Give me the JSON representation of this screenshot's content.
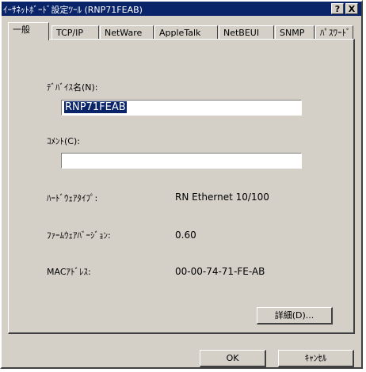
{
  "window": {
    "title": "ｲｰｻﾈｯﾄﾎﾞｰﾄﾞ設定ﾂｰﾙ (RNP71FEAB)",
    "help_label": "?",
    "close_label": "X"
  },
  "tabs": [
    {
      "label": "一般",
      "active": true
    },
    {
      "label": "TCP/IP"
    },
    {
      "label": "NetWare"
    },
    {
      "label": "AppleTalk"
    },
    {
      "label": "NetBEUI"
    },
    {
      "label": "SNMP"
    },
    {
      "label": "ﾊﾟｽﾜｰﾄﾞ"
    }
  ],
  "general": {
    "device_name_label": "ﾃﾞﾊﾞｲｽ名(N):",
    "device_name_value": "RNP71FEAB",
    "comment_label": "ｺﾒﾝﾄ(C):",
    "comment_value": "",
    "hardware_type_label": "ﾊｰﾄﾞｳｪｱﾀｲﾌﾟ:",
    "hardware_type_value": "RN Ethernet 10/100",
    "firmware_version_label": "ﾌｧｰﾑｳｪｱﾊﾞｰｼﾞｮﾝ:",
    "firmware_version_value": "0.60",
    "mac_address_label": "MACｱﾄﾞﾚｽ:",
    "mac_address_value": "00-00-74-71-FE-AB",
    "details_button": "詳細(D)..."
  },
  "footer": {
    "ok_button": "OK",
    "cancel_button": "ｷｬﾝｾﾙ"
  },
  "colors": {
    "titlebar": "#0a246a",
    "face": "#d4d0c8",
    "selection": "#0a246a"
  }
}
